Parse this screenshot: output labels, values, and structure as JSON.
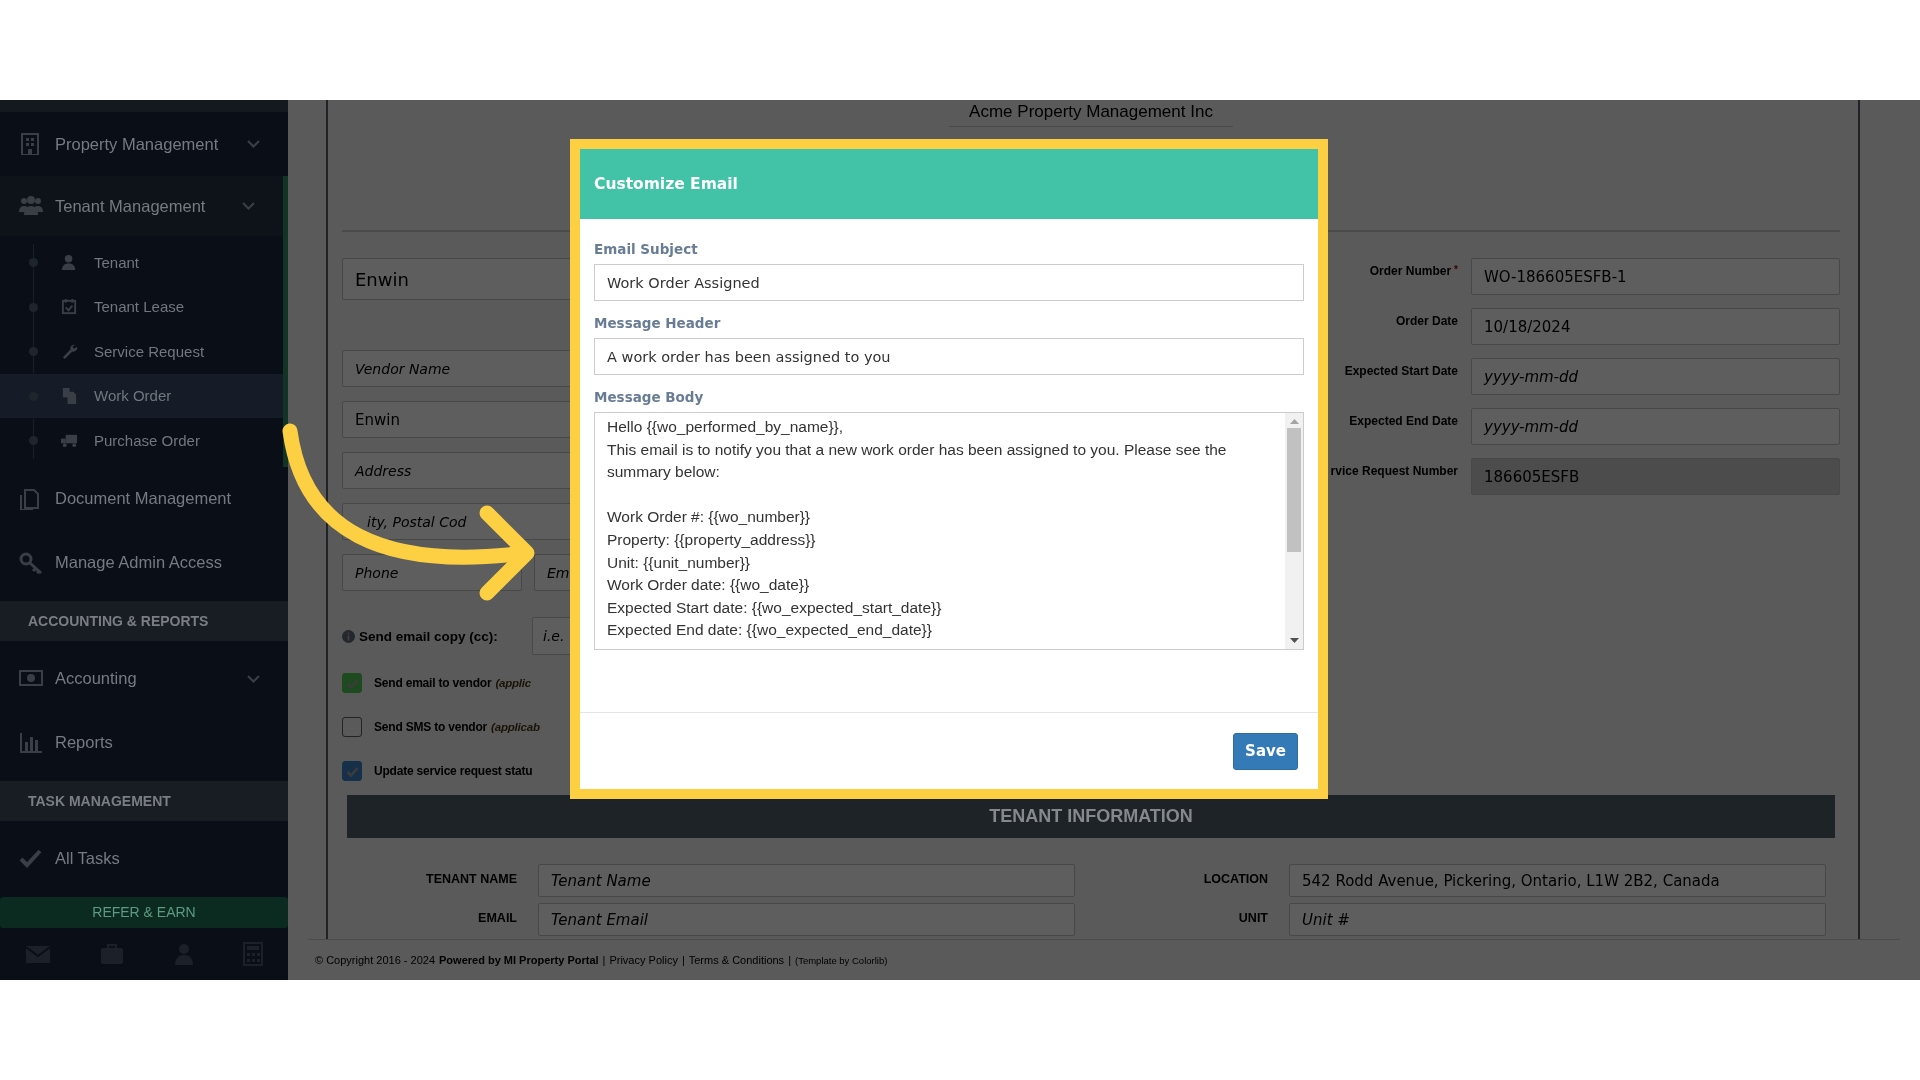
{
  "page_title": "Acme Property Management Inc",
  "sidebar": {
    "entries": [
      {
        "kind": "item",
        "label": "Property Management",
        "expanded": false,
        "selected": false
      },
      {
        "kind": "item",
        "label": "Tenant Management",
        "expanded": true,
        "selected": false,
        "children": [
          {
            "label": "Tenant",
            "selected": false
          },
          {
            "label": "Tenant Lease",
            "selected": false
          },
          {
            "label": "Service Request",
            "selected": false
          },
          {
            "label": "Work Order",
            "selected": true
          },
          {
            "label": "Purchase Order",
            "selected": false
          }
        ]
      },
      {
        "kind": "item",
        "label": "Document Management",
        "selected": false
      },
      {
        "kind": "item",
        "label": "Manage Admin Access",
        "selected": false
      },
      {
        "kind": "section",
        "label": "ACCOUNTING & REPORTS"
      },
      {
        "kind": "item",
        "label": "Accounting",
        "expanded": false,
        "selected": false
      },
      {
        "kind": "item",
        "label": "Reports",
        "selected": false
      },
      {
        "kind": "section",
        "label": "TASK MANAGEMENT"
      },
      {
        "kind": "item",
        "label": "All Tasks",
        "selected": false
      },
      {
        "kind": "button",
        "label": "REFER & EARN"
      }
    ]
  },
  "vendor": {
    "select_value": "Enwin",
    "fields": [
      {
        "placeholder": "Vendor Name"
      },
      {
        "value": "Enwin"
      },
      {
        "placeholder": "Address"
      },
      {
        "placeholder": "ity, Postal Cod"
      }
    ],
    "phone": {
      "placeholder": "Phone"
    },
    "email": {
      "placeholder": "Em"
    },
    "cc_label": "Send email copy (cc):",
    "cc_field": {
      "placeholder": "i.e."
    },
    "options": [
      {
        "label": "Send email to vendor",
        "note": "(applic",
        "checked": true,
        "color": "#1d4a1f"
      },
      {
        "label": "Send SMS to vendor",
        "note": "(applicab",
        "checked": false
      },
      {
        "label": "Update service request statu",
        "checked": true,
        "color": "#16304a"
      }
    ]
  },
  "order": {
    "fields": [
      {
        "label": "Order Number",
        "required_mark": "*",
        "value": "WO-186605ESFB-1",
        "readonly": false
      },
      {
        "label": "Order Date",
        "value": "10/18/2024",
        "readonly": false
      },
      {
        "label": "Expected Start Date",
        "placeholder": "yyyy-mm-dd",
        "readonly": false
      },
      {
        "label": "Expected End Date",
        "placeholder": "yyyy-mm-dd",
        "readonly": false
      },
      {
        "label": "rvice Request Number",
        "value": "186605ESFB",
        "readonly": true
      }
    ]
  },
  "tenant": {
    "title": "TENANT INFORMATION",
    "fields": [
      {
        "label": "TENANT NAME",
        "placeholder": "Tenant Name"
      },
      {
        "label": "LOCATION",
        "value": "542 Rodd Avenue, Pickering, Ontario, L1W 2B2, Canada"
      },
      {
        "label": "EMAIL",
        "placeholder": "Tenant Email"
      },
      {
        "label": "UNIT",
        "placeholder": "Unit #"
      }
    ]
  },
  "footer": [
    {
      "kind": "text",
      "text": "© Copyright 2016 - 2024"
    },
    {
      "kind": "bold",
      "text": "Powered by MI Property Portal"
    },
    {
      "kind": "sep",
      "text": "|"
    },
    {
      "kind": "link",
      "text": "Privacy Policy"
    },
    {
      "kind": "sep",
      "text": "|"
    },
    {
      "kind": "link",
      "text": "Terms & Conditions"
    },
    {
      "kind": "sep",
      "text": "|"
    },
    {
      "kind": "small",
      "text": "(Template by Colorlib)"
    }
  ],
  "modal": {
    "title": "Customize Email",
    "fields": [
      {
        "kind": "input",
        "label": "Email Subject",
        "value": "Work Order Assigned"
      },
      {
        "kind": "input",
        "label": "Message Header",
        "value": "A work order has been assigned to you"
      },
      {
        "kind": "textarea",
        "label": "Message Body",
        "value": "Hello {{wo_performed_by_name}},\nThis email is to notify you that a new work order has been assigned to you. Please see the summary below:\n\nWork Order #: {{wo_number}}\nProperty: {{property_address}}\nUnit: {{unit_number}}\nWork Order date: {{wo_date}}\nExpected Start date: {{wo_expected_start_date}}\nExpected End date: {{wo_expected_end_date}}"
      }
    ],
    "buttons": [
      {
        "label": "Save"
      }
    ]
  }
}
